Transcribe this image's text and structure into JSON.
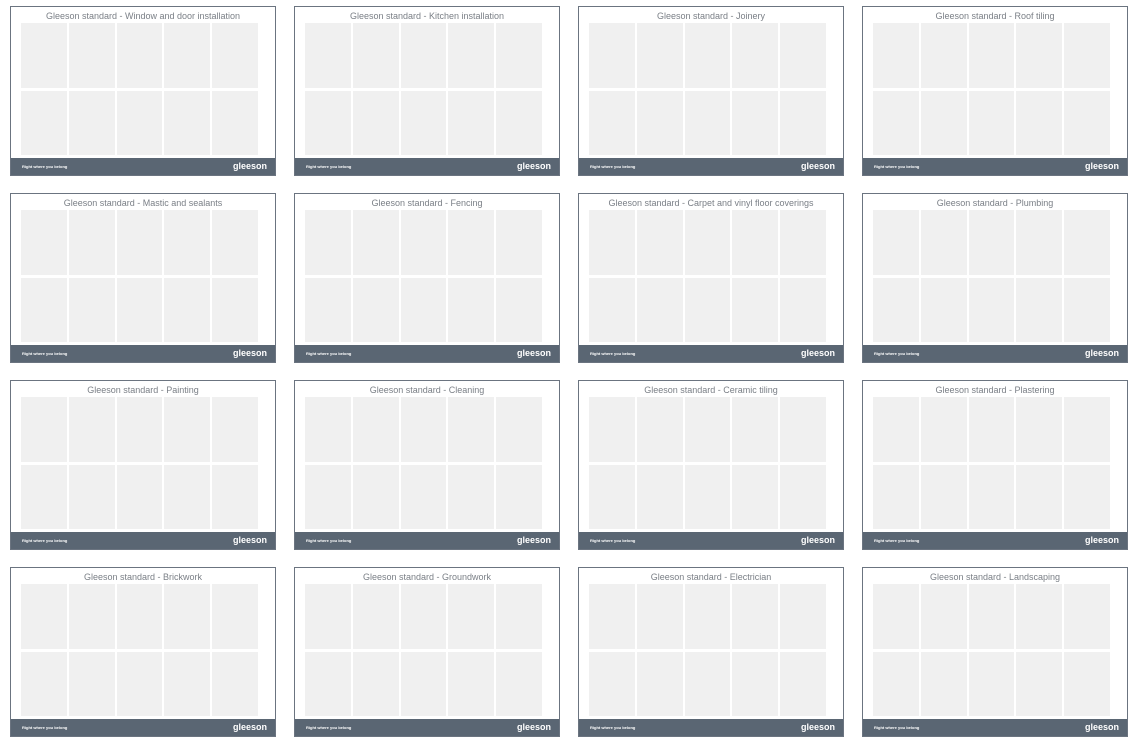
{
  "footer": {
    "tagline": "Right where you belong",
    "logo": "gleeson"
  },
  "cards": [
    {
      "title": "Gleeson standard - Window and door installation"
    },
    {
      "title": "Gleeson standard - Kitchen installation"
    },
    {
      "title": "Gleeson standard - Joinery"
    },
    {
      "title": "Gleeson standard - Roof tiling"
    },
    {
      "title": "Gleeson standard - Mastic and sealants"
    },
    {
      "title": "Gleeson standard - Fencing"
    },
    {
      "title": "Gleeson standard - Carpet and vinyl floor coverings"
    },
    {
      "title": "Gleeson standard - Plumbing"
    },
    {
      "title": "Gleeson standard - Painting"
    },
    {
      "title": "Gleeson standard - Cleaning"
    },
    {
      "title": "Gleeson standard - Ceramic tiling"
    },
    {
      "title": "Gleeson standard - Plastering"
    },
    {
      "title": "Gleeson standard - Brickwork"
    },
    {
      "title": "Gleeson standard - Groundwork"
    },
    {
      "title": "Gleeson standard - Electrician"
    },
    {
      "title": "Gleeson standard - Landscaping"
    }
  ]
}
